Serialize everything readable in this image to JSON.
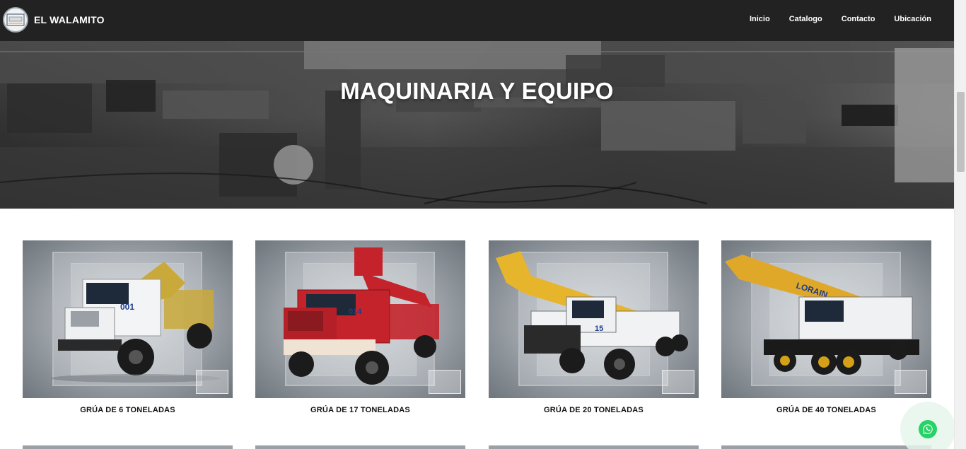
{
  "header": {
    "brand": "EL WALAMITO",
    "logo_icon": "walamito-logo-icon",
    "nav": [
      "Inicio",
      "Catalogo",
      "Contacto",
      "Ubicación"
    ]
  },
  "hero": {
    "title": "MAQUINARIA Y EQUIPO"
  },
  "catalog": {
    "items": [
      {
        "title": "GRÚA DE 6 TONELADAS",
        "unit_number": "001",
        "cab_color": "#f3f4f6",
        "boom_color": "#c9a93a"
      },
      {
        "title": "GRÚA DE 17 TONELADAS",
        "unit_number": "014",
        "cab_color": "#c4232b",
        "boom_color": "#c4232b"
      },
      {
        "title": "GRÚA DE 20 TONELADAS",
        "unit_number": "15",
        "cab_color": "#f1f2f4",
        "boom_color": "#e7b52b"
      },
      {
        "title": "GRÚA DE 40 TONELADAS",
        "unit_number": "LORAIN",
        "cab_color": "#f0f1f3",
        "boom_color": "#e0a829"
      }
    ]
  },
  "whatsapp": {
    "icon": "whatsapp-icon",
    "color": "#25d366"
  }
}
